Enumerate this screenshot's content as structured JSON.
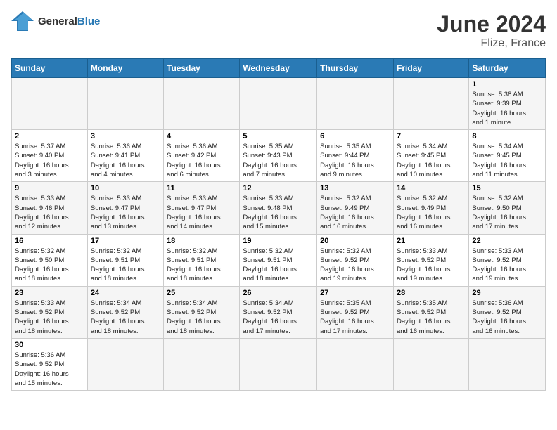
{
  "header": {
    "logo_general": "General",
    "logo_blue": "Blue",
    "month_year": "June 2024",
    "location": "Flize, France"
  },
  "weekdays": [
    "Sunday",
    "Monday",
    "Tuesday",
    "Wednesday",
    "Thursday",
    "Friday",
    "Saturday"
  ],
  "weeks": [
    [
      {
        "day": "",
        "info": ""
      },
      {
        "day": "",
        "info": ""
      },
      {
        "day": "",
        "info": ""
      },
      {
        "day": "",
        "info": ""
      },
      {
        "day": "",
        "info": ""
      },
      {
        "day": "",
        "info": ""
      },
      {
        "day": "1",
        "info": "Sunrise: 5:38 AM\nSunset: 9:39 PM\nDaylight: 16 hours\nand 1 minute."
      }
    ],
    [
      {
        "day": "2",
        "info": "Sunrise: 5:37 AM\nSunset: 9:40 PM\nDaylight: 16 hours\nand 3 minutes."
      },
      {
        "day": "3",
        "info": "Sunrise: 5:36 AM\nSunset: 9:41 PM\nDaylight: 16 hours\nand 4 minutes."
      },
      {
        "day": "4",
        "info": "Sunrise: 5:36 AM\nSunset: 9:42 PM\nDaylight: 16 hours\nand 6 minutes."
      },
      {
        "day": "5",
        "info": "Sunrise: 5:35 AM\nSunset: 9:43 PM\nDaylight: 16 hours\nand 7 minutes."
      },
      {
        "day": "6",
        "info": "Sunrise: 5:35 AM\nSunset: 9:44 PM\nDaylight: 16 hours\nand 9 minutes."
      },
      {
        "day": "7",
        "info": "Sunrise: 5:34 AM\nSunset: 9:45 PM\nDaylight: 16 hours\nand 10 minutes."
      },
      {
        "day": "8",
        "info": "Sunrise: 5:34 AM\nSunset: 9:45 PM\nDaylight: 16 hours\nand 11 minutes."
      }
    ],
    [
      {
        "day": "9",
        "info": "Sunrise: 5:33 AM\nSunset: 9:46 PM\nDaylight: 16 hours\nand 12 minutes."
      },
      {
        "day": "10",
        "info": "Sunrise: 5:33 AM\nSunset: 9:47 PM\nDaylight: 16 hours\nand 13 minutes."
      },
      {
        "day": "11",
        "info": "Sunrise: 5:33 AM\nSunset: 9:47 PM\nDaylight: 16 hours\nand 14 minutes."
      },
      {
        "day": "12",
        "info": "Sunrise: 5:33 AM\nSunset: 9:48 PM\nDaylight: 16 hours\nand 15 minutes."
      },
      {
        "day": "13",
        "info": "Sunrise: 5:32 AM\nSunset: 9:49 PM\nDaylight: 16 hours\nand 16 minutes."
      },
      {
        "day": "14",
        "info": "Sunrise: 5:32 AM\nSunset: 9:49 PM\nDaylight: 16 hours\nand 16 minutes."
      },
      {
        "day": "15",
        "info": "Sunrise: 5:32 AM\nSunset: 9:50 PM\nDaylight: 16 hours\nand 17 minutes."
      }
    ],
    [
      {
        "day": "16",
        "info": "Sunrise: 5:32 AM\nSunset: 9:50 PM\nDaylight: 16 hours\nand 18 minutes."
      },
      {
        "day": "17",
        "info": "Sunrise: 5:32 AM\nSunset: 9:51 PM\nDaylight: 16 hours\nand 18 minutes."
      },
      {
        "day": "18",
        "info": "Sunrise: 5:32 AM\nSunset: 9:51 PM\nDaylight: 16 hours\nand 18 minutes."
      },
      {
        "day": "19",
        "info": "Sunrise: 5:32 AM\nSunset: 9:51 PM\nDaylight: 16 hours\nand 18 minutes."
      },
      {
        "day": "20",
        "info": "Sunrise: 5:32 AM\nSunset: 9:52 PM\nDaylight: 16 hours\nand 19 minutes."
      },
      {
        "day": "21",
        "info": "Sunrise: 5:33 AM\nSunset: 9:52 PM\nDaylight: 16 hours\nand 19 minutes."
      },
      {
        "day": "22",
        "info": "Sunrise: 5:33 AM\nSunset: 9:52 PM\nDaylight: 16 hours\nand 19 minutes."
      }
    ],
    [
      {
        "day": "23",
        "info": "Sunrise: 5:33 AM\nSunset: 9:52 PM\nDaylight: 16 hours\nand 18 minutes."
      },
      {
        "day": "24",
        "info": "Sunrise: 5:34 AM\nSunset: 9:52 PM\nDaylight: 16 hours\nand 18 minutes."
      },
      {
        "day": "25",
        "info": "Sunrise: 5:34 AM\nSunset: 9:52 PM\nDaylight: 16 hours\nand 18 minutes."
      },
      {
        "day": "26",
        "info": "Sunrise: 5:34 AM\nSunset: 9:52 PM\nDaylight: 16 hours\nand 17 minutes."
      },
      {
        "day": "27",
        "info": "Sunrise: 5:35 AM\nSunset: 9:52 PM\nDaylight: 16 hours\nand 17 minutes."
      },
      {
        "day": "28",
        "info": "Sunrise: 5:35 AM\nSunset: 9:52 PM\nDaylight: 16 hours\nand 16 minutes."
      },
      {
        "day": "29",
        "info": "Sunrise: 5:36 AM\nSunset: 9:52 PM\nDaylight: 16 hours\nand 16 minutes."
      }
    ],
    [
      {
        "day": "30",
        "info": "Sunrise: 5:36 AM\nSunset: 9:52 PM\nDaylight: 16 hours\nand 15 minutes."
      },
      {
        "day": "",
        "info": ""
      },
      {
        "day": "",
        "info": ""
      },
      {
        "day": "",
        "info": ""
      },
      {
        "day": "",
        "info": ""
      },
      {
        "day": "",
        "info": ""
      },
      {
        "day": "",
        "info": ""
      }
    ]
  ]
}
